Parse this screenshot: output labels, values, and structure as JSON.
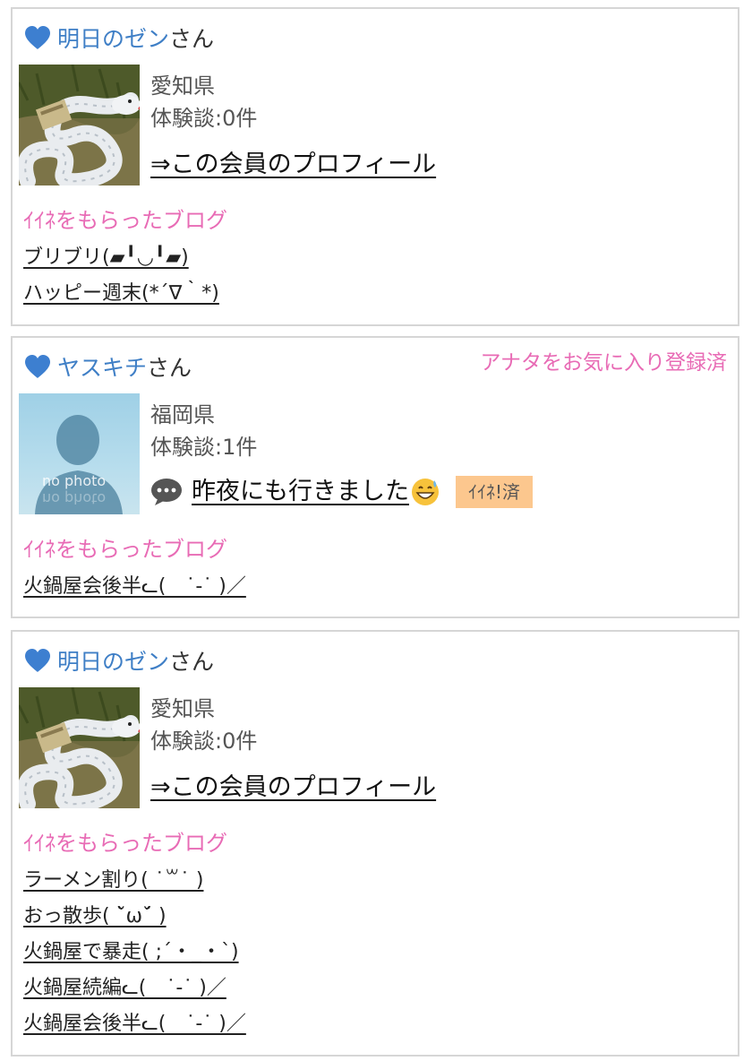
{
  "cards": [
    {
      "name": "明日のゼン",
      "suffix": "さん",
      "prefecture": "愛知県",
      "experience": "体験談:0件",
      "profile_link": "⇒この会員のプロフィール",
      "blog_heading": "ｲｲﾈをもらったブログ",
      "blogs": [
        "ブリブリ(▰╹◡╹▰)",
        "ハッピー週末(*´∇｀*)"
      ]
    },
    {
      "name": "ヤスキチ",
      "suffix": "さん",
      "fav_status": "アナタをお気に入り登録済",
      "prefecture": "福岡県",
      "experience": "体験談:1件",
      "comment": "昨夜にも行きました",
      "like_badge": "ｲｲﾈ!済",
      "avatar_text": "no photo",
      "blog_heading": "ｲｲﾈをもらったブログ",
      "blogs": [
        "火鍋屋会後半ᓚ(　˙-˙ )／"
      ]
    },
    {
      "name": "明日のゼン",
      "suffix": "さん",
      "prefecture": "愛知県",
      "experience": "体験談:0件",
      "profile_link": "⇒この会員のプロフィール",
      "blog_heading": "ｲｲﾈをもらったブログ",
      "blogs": [
        "ラーメン割り( ˙꒳˙ )",
        "おっ散歩( ˘̀ω˘́ )",
        "火鍋屋で暴走( ;´・_・`)",
        "火鍋屋続編ᓚ(　˙-˙ )／",
        "火鍋屋会後半ᓚ(　˙-˙ )／"
      ]
    }
  ],
  "colors": {
    "name": "#3f7fc6",
    "pink": "#e86bb5",
    "heart": "#3d7fd0",
    "badge": "#fcc78e"
  },
  "icons": {
    "heart": "heart-icon",
    "snake_avatar": "snake-photo-avatar",
    "no_photo": "no-photo-avatar",
    "speech": "speech-bubble-icon",
    "grin": "grinning-sweat-emoji-icon"
  }
}
